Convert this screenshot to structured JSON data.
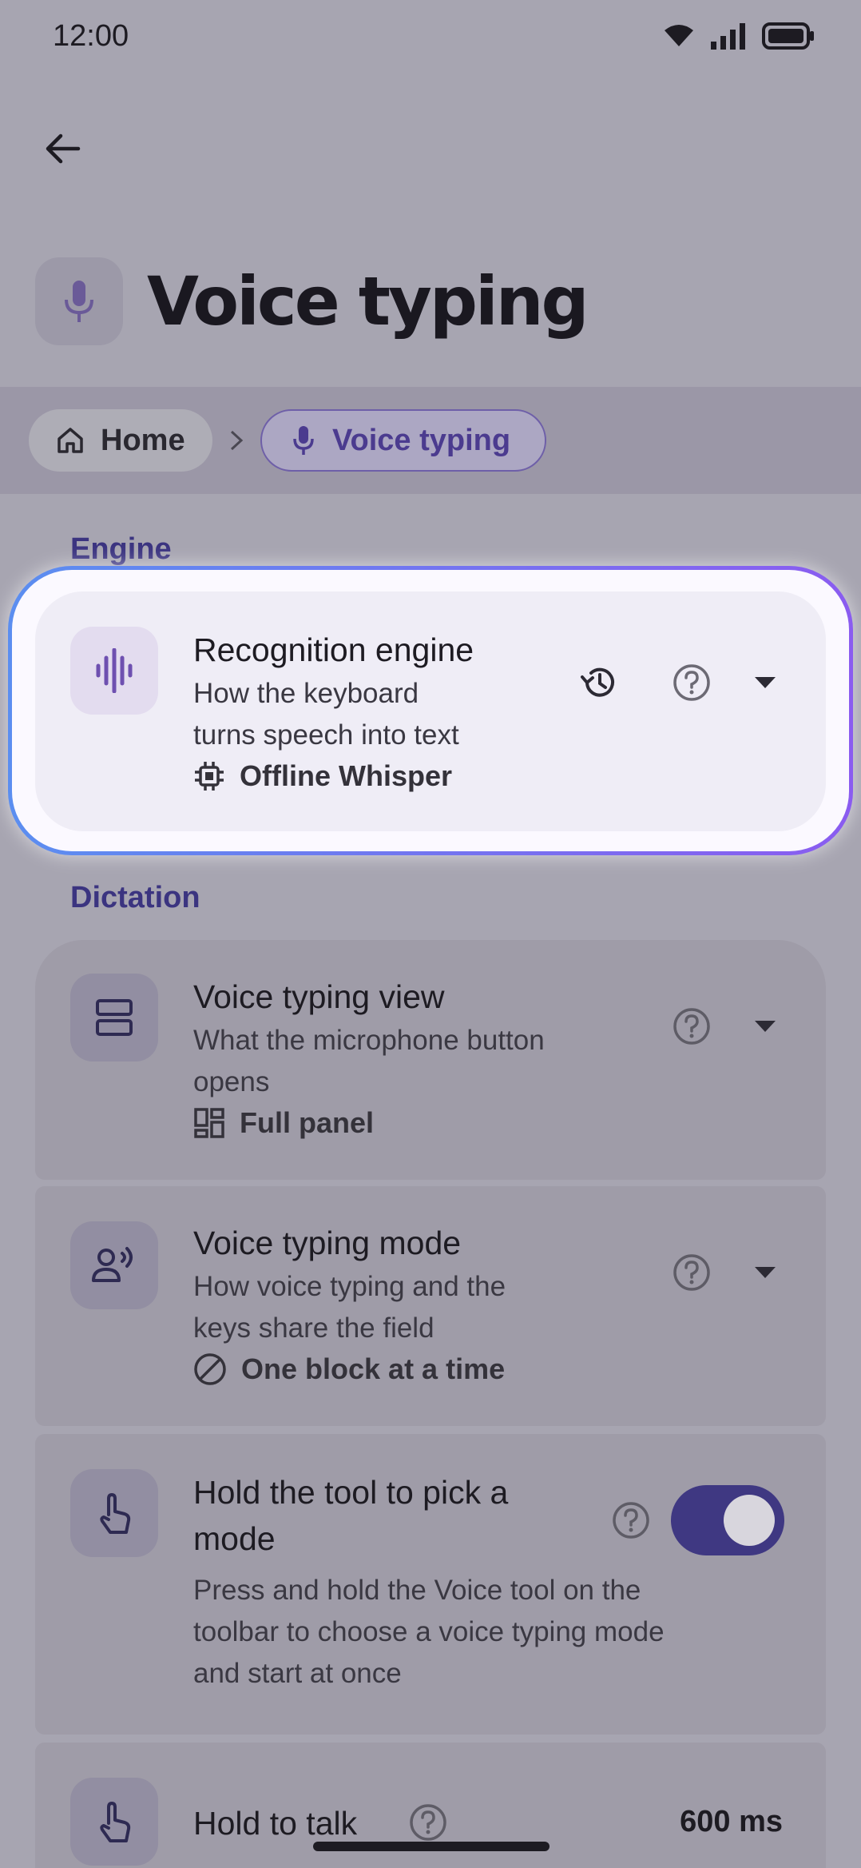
{
  "status": {
    "time": "12:00"
  },
  "header": {
    "title": "Voice typing"
  },
  "breadcrumb": {
    "home": "Home",
    "current": "Voice typing"
  },
  "sections": {
    "engine": "Engine",
    "dictation": "Dictation"
  },
  "engine_card": {
    "title": "Recognition engine",
    "subtitle_line1": "How the keyboard",
    "subtitle_line2": "turns speech into text",
    "value": "Offline Whisper"
  },
  "view_card": {
    "title": "Voice typing view",
    "subtitle_line1": "What the microphone button",
    "subtitle_line2": "opens",
    "value": "Full panel"
  },
  "mode_card": {
    "title": "Voice typing mode",
    "subtitle_line1": "How voice typing and the",
    "subtitle_line2": "keys share the field",
    "value": "One block at a time"
  },
  "hold_pick_card": {
    "title_line1": "Hold the tool to pick a",
    "title_line2": "mode",
    "subtitle_line1": "Press and hold the Voice tool on the",
    "subtitle_line2": "toolbar to choose a voice typing mode",
    "subtitle_line3": "and start at once",
    "toggle_on": true
  },
  "hold_talk_card": {
    "title": "Hold to talk",
    "value": "600 ms"
  },
  "colors": {
    "accent": "#3f3882",
    "ring_start": "#5b8ef0",
    "ring_end": "#8a5cf0"
  }
}
